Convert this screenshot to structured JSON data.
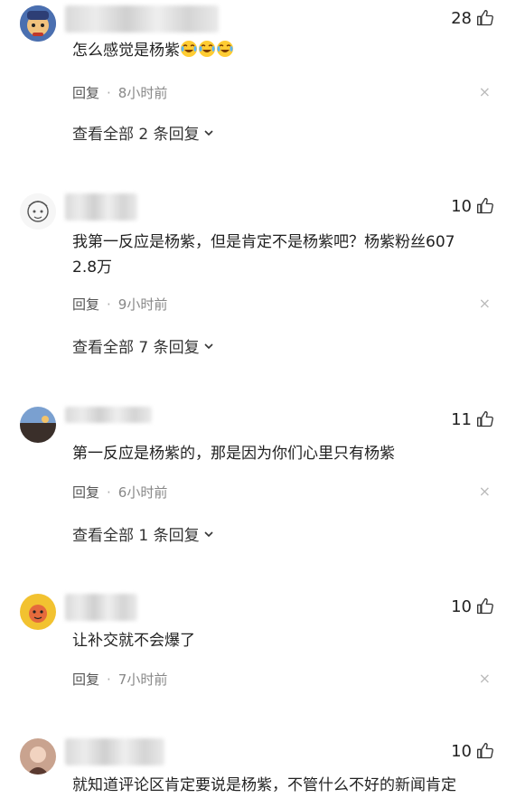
{
  "comments": [
    {
      "likes": "28",
      "text": "怎么感觉是杨紫",
      "emoji_count": 3,
      "reply_label": "回复",
      "dot": "·",
      "time": "8小时前",
      "view_all": "查看全部 2 条回复"
    },
    {
      "likes": "10",
      "text_line1": "我第一反应是杨紫，但是肯定不是杨紫吧？杨紫粉丝607",
      "text_line2": "2.8万",
      "reply_label": "回复",
      "dot": "·",
      "time": "9小时前",
      "view_all": "查看全部 7 条回复"
    },
    {
      "likes": "11",
      "text": "第一反应是杨紫的，那是因为你们心里只有杨紫",
      "reply_label": "回复",
      "dot": "·",
      "time": "6小时前",
      "view_all": "查看全部 1 条回复"
    },
    {
      "likes": "10",
      "text": "让补交就不会爆了",
      "reply_label": "回复",
      "dot": "·",
      "time": "7小时前"
    },
    {
      "likes": "10",
      "text": "就知道评论区肯定要说是杨紫，不管什么不好的新闻肯定"
    }
  ],
  "close_glyph": "×",
  "colors": {
    "text": "#222222",
    "meta": "#888888",
    "close": "#bbbbbb"
  }
}
